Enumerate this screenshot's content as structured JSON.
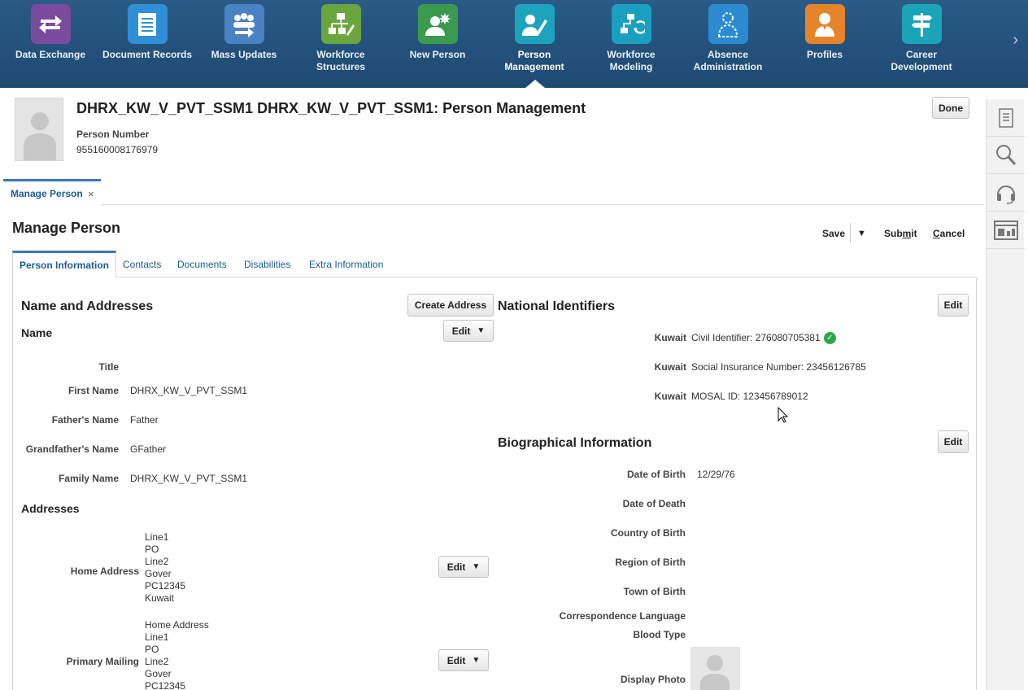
{
  "springboard": {
    "items": [
      {
        "label_1": "Data Exchange",
        "label_2": "",
        "color": "#7a4b9c",
        "icon": "exchange-icon"
      },
      {
        "label_1": "Document Records",
        "label_2": "",
        "color": "#2f8fd6",
        "icon": "document-icon"
      },
      {
        "label_1": "Mass Updates",
        "label_2": "",
        "color": "#4a83c4",
        "icon": "group-icon"
      },
      {
        "label_1": "Workforce",
        "label_2": "Structures",
        "color": "#6aa63d",
        "icon": "org-chart-icon"
      },
      {
        "label_1": "New Person",
        "label_2": "",
        "color": "#3c9a4f",
        "icon": "new-person-icon"
      },
      {
        "label_1": "Person",
        "label_2": "Management",
        "color": "#1ea3bd",
        "icon": "person-edit-icon"
      },
      {
        "label_1": "Workforce Modeling",
        "label_2": "",
        "color": "#1b9fc0",
        "icon": "modeling-icon"
      },
      {
        "label_1": "Absence",
        "label_2": "Administration",
        "color": "#2b8ad2",
        "icon": "absence-icon"
      },
      {
        "label_1": "Profiles",
        "label_2": "",
        "color": "#e6842b",
        "icon": "profile-icon"
      },
      {
        "label_1": "Career Development",
        "label_2": "",
        "color": "#1aa4b8",
        "icon": "signpost-icon"
      }
    ]
  },
  "header": {
    "title": "DHRX_KW_V_PVT_SSM1 DHRX_KW_V_PVT_SSM1: Person Management",
    "person_number_label": "Person Number",
    "person_number": "955160008176979",
    "done": "Done"
  },
  "doc_tab": {
    "label": "Manage Person",
    "close": "×"
  },
  "region": {
    "title": "Manage Person",
    "save": "Save",
    "submit_pre": "Sub",
    "submit_u": "m",
    "submit_post": "it",
    "cancel_u": "C",
    "cancel_post": "ancel"
  },
  "subtabs": [
    "Person Information",
    "Contacts",
    "Documents",
    "Disabilities",
    "Extra Information"
  ],
  "name_addresses": {
    "title": "Name and Addresses",
    "create_address": "Create Address",
    "name_title": "Name",
    "edit": "Edit",
    "fields": [
      {
        "label": "Title",
        "value": ""
      },
      {
        "label": "First Name",
        "value": "DHRX_KW_V_PVT_SSM1"
      },
      {
        "label": "Father's Name",
        "value": "Father"
      },
      {
        "label": "Grandfather's Name",
        "value": "GFather"
      },
      {
        "label": "Family Name",
        "value": "DHRX_KW_V_PVT_SSM1"
      }
    ],
    "addresses_title": "Addresses",
    "home_label": "Home Address",
    "home_lines": [
      "Line1",
      "PO",
      "Line2",
      "Gover",
      "PC12345",
      "Kuwait"
    ],
    "mailing_label": "Primary Mailing",
    "mailing_lines": [
      "Home Address",
      "Line1",
      "PO",
      "Line2",
      "Gover",
      "PC12345"
    ]
  },
  "national_identifiers": {
    "title": "National Identifiers",
    "edit": "Edit",
    "items": [
      {
        "country": "Kuwait",
        "text": "Civil Identifier: 276080705381",
        "verified": true
      },
      {
        "country": "Kuwait",
        "text": "Social Insurance Number: 23456126785",
        "verified": false
      },
      {
        "country": "Kuwait",
        "text": "MOSAL ID: 123456789012",
        "verified": false
      }
    ]
  },
  "biographical": {
    "title": "Biographical Information",
    "edit": "Edit",
    "fields": [
      {
        "label": "Date of Birth",
        "value": "12/29/76"
      },
      {
        "label": "Date of Death",
        "value": ""
      },
      {
        "label": "Country of Birth",
        "value": ""
      },
      {
        "label": "Region of Birth",
        "value": ""
      },
      {
        "label": "Town of Birth",
        "value": ""
      },
      {
        "label": "Correspondence Language",
        "value": ""
      },
      {
        "label": "Blood Type",
        "value": ""
      },
      {
        "label": "Display Photo",
        "value": ""
      }
    ]
  },
  "sidepanel": [
    "tasks-icon",
    "search-icon",
    "help-headset-icon",
    "report-icon"
  ]
}
